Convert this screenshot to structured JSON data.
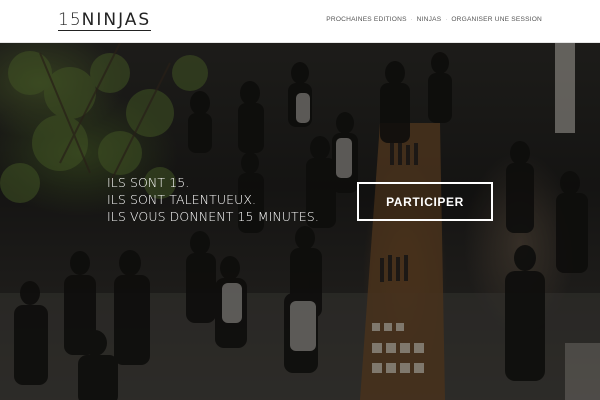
{
  "header": {
    "logo": {
      "number": "15",
      "name": "NINJAS"
    },
    "nav": [
      {
        "label": "PROCHAINES EDITIONS"
      },
      {
        "label": "NINJAS"
      },
      {
        "label": "ORGANISER UNE SESSION"
      }
    ],
    "nav_separator": "·"
  },
  "hero": {
    "headline": [
      "ILS  SONT 15.",
      "ILS SONT TALENTUEUX.",
      "ILS VOUS DONNENT 15 MINUTES."
    ],
    "cta_label": "PARTICIPER"
  },
  "colors": {
    "header_bg": "#ffffff",
    "nav_text": "#555555",
    "hero_text": "#ffffff",
    "cta_border": "#ffffff"
  }
}
